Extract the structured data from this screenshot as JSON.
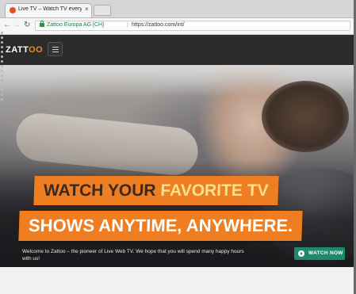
{
  "browser": {
    "tab_title": "Live TV – Watch TV every",
    "tab_close": "×",
    "secure_label": "Zattoo Europa AG [CH]",
    "separator": "|",
    "url": "https://zattoo.com/int/"
  },
  "site": {
    "logo_prefix": "ZATT",
    "logo_highlight": "OO",
    "headline_line1_a": "WATCH YOUR ",
    "headline_line1_b": "FAVORITE TV",
    "headline_line2": "SHOWS ANYTIME, ANYWHERE.",
    "welcome_text": "Welcome to Zattoo – the pioneer of Live Web TV. We hope that you will spend many happy hours with us!",
    "cta_label": "WATCH NOW"
  },
  "colors": {
    "brand_orange": "#ef7d22",
    "cta_green": "#1f8a6a",
    "header_bg": "#2b2b2b"
  },
  "icons": [
    "back-arrow-icon",
    "forward-arrow-icon",
    "reload-icon",
    "lock-icon",
    "hamburger-menu-icon",
    "play-icon",
    "favicon-icon"
  ]
}
